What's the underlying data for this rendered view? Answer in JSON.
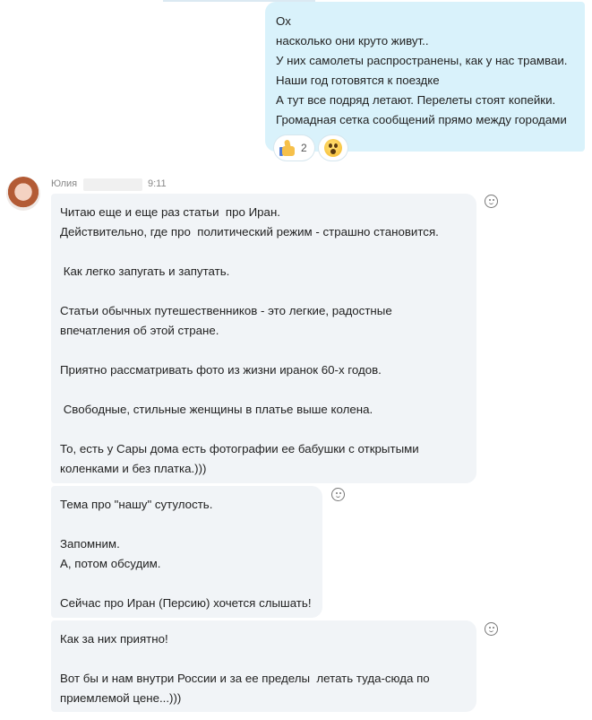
{
  "outgoing": {
    "lines": [
      "Ох",
      "насколько они круто живут..",
      "У них самолеты распространены, как у нас трамваи.",
      "Наши год готовятся к поездке",
      "А тут все подряд летают. Перелеты стоят копейки.",
      "Громадная сетка сообщений прямо между городами"
    ],
    "reactions": [
      {
        "icon": "thumbs-up-icon",
        "count": "2"
      },
      {
        "icon": "astonished-face-icon"
      }
    ]
  },
  "incoming": {
    "sender": "Юлия",
    "time": "9:11",
    "messages": [
      {
        "lines": [
          "Читаю еще и еще раз статьи  про Иран.",
          "Действительно, где про  политический режим - страшно становится.",
          "",
          " Как легко запугать и запутать.",
          "",
          "Статьи обычных путешественников - это легкие, радостные",
          "впечатления об этой стране.",
          "",
          "Приятно рассматривать фото из жизни иранок 60-х годов.",
          "",
          " Свободные, стильные женщины в платье выше колена.",
          "",
          "То, есть у Сары дома есть фотографии ее бабушки с открытыми",
          "коленками и без платка.)))"
        ]
      },
      {
        "lines": [
          "Тема про \"нашу\" сутулость.",
          "",
          "Запомним.",
          "А, потом обсудим.",
          "",
          "Сейчас про Иран (Персию) хочется слышать!"
        ]
      },
      {
        "lines": [
          "Как за них приятно!",
          "",
          "Вот бы и нам внутри России и за ее пределы  летать туда-сюда по",
          "приемлемой цене...)))"
        ]
      }
    ]
  },
  "colors": {
    "outgoing_bubble": "#d9f2fb",
    "incoming_bubble": "#f1f4f7",
    "meta_text": "#888888"
  }
}
